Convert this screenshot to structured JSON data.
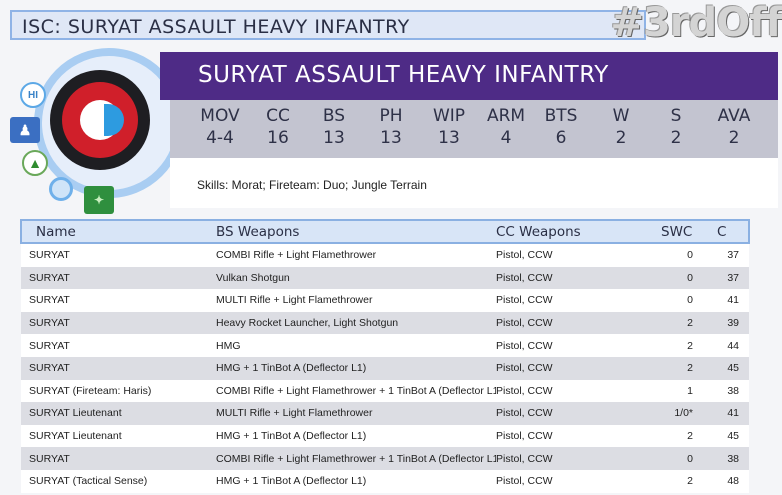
{
  "header": {
    "title": "ISC: SURYAT ASSAULT HEAVY INFANTRY",
    "hashtag": "#3rdOff"
  },
  "profile": {
    "name": "SURYAT ASSAULT HEAVY INFANTRY",
    "stats": [
      {
        "label": "MOV",
        "value": "4-4"
      },
      {
        "label": "CC",
        "value": "16"
      },
      {
        "label": "BS",
        "value": "13"
      },
      {
        "label": "PH",
        "value": "13"
      },
      {
        "label": "WIP",
        "value": "13"
      },
      {
        "label": "ARM",
        "value": "4"
      },
      {
        "label": "BTS",
        "value": "6"
      },
      {
        "label": "W",
        "value": "2"
      },
      {
        "label": "S",
        "value": "2"
      },
      {
        "label": "AVA",
        "value": "2"
      }
    ],
    "skills": "Skills: Morat; Fireteam: Duo; Jungle Terrain",
    "icons": {
      "hi": "HI",
      "troop": "troop-type-icon",
      "impetuous": "triangle-icon",
      "cube": "ring-icon",
      "camo": "camo-icon"
    }
  },
  "table": {
    "headers": [
      "Name",
      "BS Weapons",
      "CC Weapons",
      "SWC",
      "C"
    ],
    "rows": [
      [
        "SURYAT",
        "COMBI Rifle + Light Flamethrower",
        "Pistol, CCW",
        "0",
        "37"
      ],
      [
        "SURYAT",
        "Vulkan Shotgun",
        "Pistol, CCW",
        "0",
        "37"
      ],
      [
        "SURYAT",
        "MULTI Rifle + Light Flamethrower",
        "Pistol, CCW",
        "0",
        "41"
      ],
      [
        "SURYAT",
        "Heavy Rocket Launcher, Light Shotgun",
        "Pistol, CCW",
        "2",
        "39"
      ],
      [
        "SURYAT",
        "HMG",
        "Pistol, CCW",
        "2",
        "44"
      ],
      [
        "SURYAT",
        "HMG + 1 TinBot A (Deflector L1)",
        "Pistol, CCW",
        "2",
        "45"
      ],
      [
        "SURYAT (Fireteam: Haris)",
        "COMBI Rifle + Light Flamethrower + 1 TinBot A (Deflector L1)",
        "Pistol, CCW",
        "1",
        "38"
      ],
      [
        "SURYAT Lieutenant",
        "MULTI Rifle + Light Flamethrower",
        "Pistol, CCW",
        "1/0*",
        "41"
      ],
      [
        "SURYAT Lieutenant",
        "HMG + 1 TinBot A (Deflector L1)",
        "Pistol, CCW",
        "2",
        "45"
      ],
      [
        "SURYAT",
        "COMBI Rifle + Light Flamethrower + 1 TinBot A (Deflector L1)",
        "Pistol, CCW",
        "0",
        "38"
      ],
      [
        "SURYAT (Tactical Sense)",
        "HMG + 1 TinBot A (Deflector L1)",
        "Pistol, CCW",
        "2",
        "48"
      ]
    ]
  }
}
